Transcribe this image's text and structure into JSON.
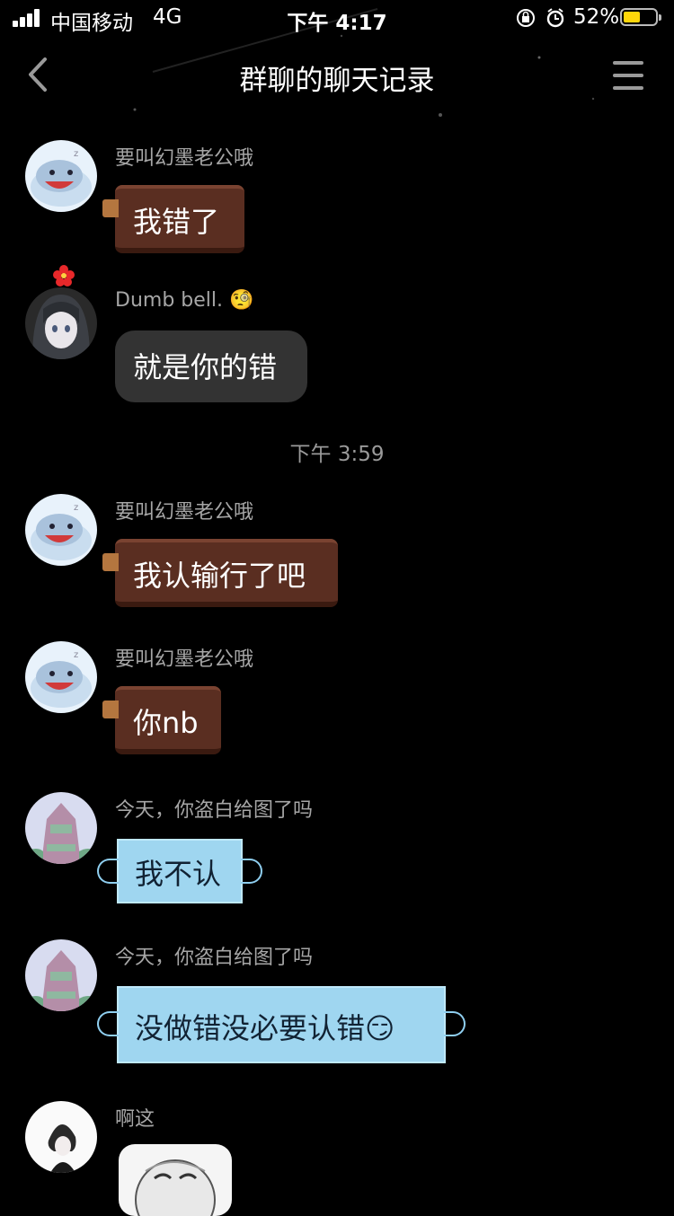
{
  "status_bar": {
    "carrier": "中国移动",
    "network": "4G",
    "time": "下午 4:17",
    "battery_percent": "52%",
    "battery_level": 0.52,
    "battery_color": "#ffd60a"
  },
  "nav": {
    "title": "群聊的聊天记录",
    "back_icon": "chevron-left-icon",
    "menu_icon": "hamburger-menu-icon"
  },
  "messages": [
    {
      "sender": "要叫幻墨老公哦",
      "text": "我错了",
      "bubble_style": "chocolate"
    },
    {
      "sender": "Dumb bell.",
      "sender_emoji": "🧐",
      "text": "就是你的错",
      "bubble_style": "dark"
    },
    {
      "sender": "要叫幻墨老公哦",
      "text": "我认输行了吧",
      "bubble_style": "chocolate"
    },
    {
      "sender": "要叫幻墨老公哦",
      "text": "你nb",
      "bubble_style": "chocolate"
    },
    {
      "sender": "今天，你盗白给图了吗",
      "text": "我不认",
      "bubble_style": "mask"
    },
    {
      "sender": "今天，你盗白给图了吗",
      "text": "没做错没必要认错",
      "text_emoji": "😏",
      "bubble_style": "mask"
    },
    {
      "sender": "啊这",
      "content": "sticker-image",
      "bubble_style": "image"
    }
  ],
  "timestamp": "下午 3:59",
  "colors": {
    "background": "#000000",
    "chocolate_bubble": "#5a2e21",
    "dark_bubble": "#333333",
    "mask_bubble": "#9fd6f0",
    "sender_name": "#a6a6a6"
  }
}
